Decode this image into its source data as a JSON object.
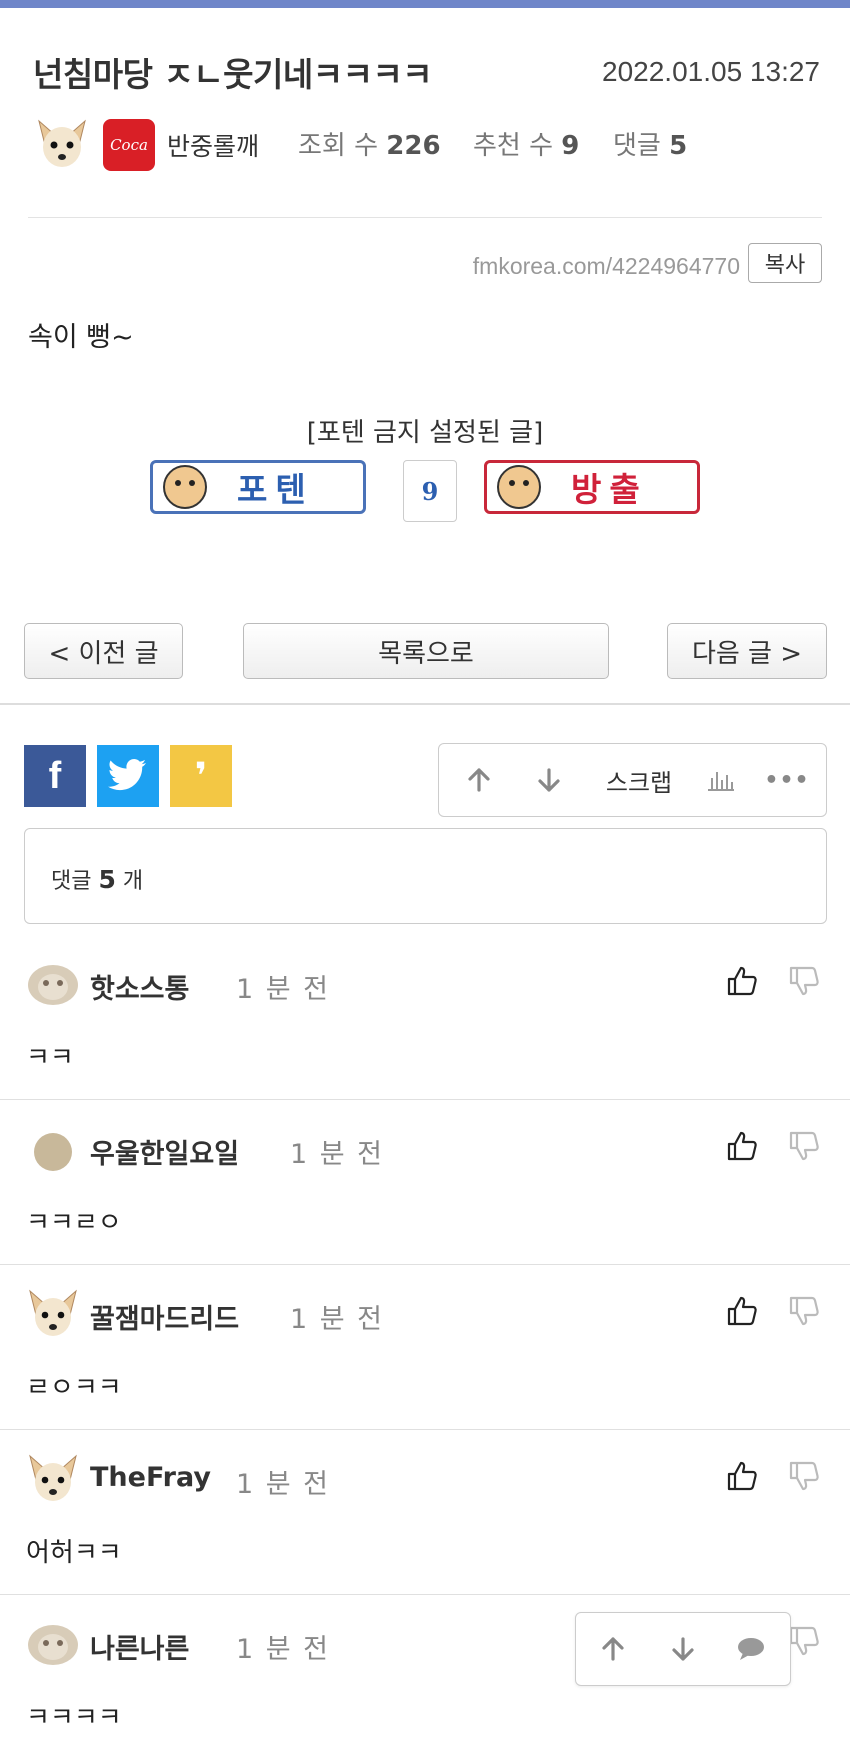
{
  "post": {
    "title": "넌침마당 ㅈㄴ웃기네ㅋㅋㅋㅋ",
    "datetime": "2022.01.05 13:27",
    "author": "반중롤깨",
    "badge_text": "Coca",
    "views_label": "조회 수",
    "views": "226",
    "recommend_label": "추천 수",
    "recommend": "9",
    "comments_label": "댓글",
    "comments": "5",
    "url": "fmkorea.com/4224964770",
    "copy_label": "복사",
    "body": "속이 뻥~"
  },
  "vote": {
    "notice": "[포텐 금지 설정된 글]",
    "up_label": "포텐",
    "down_label": "방출",
    "count": "9"
  },
  "nav": {
    "prev": "< 이전 글",
    "list": "목록으로",
    "next": "다음 글 >"
  },
  "share": {
    "facebook": "f",
    "kakaostory": "❜"
  },
  "tools": {
    "scrap": "스크랩",
    "more": "•••"
  },
  "comment_summary": {
    "label": "댓글",
    "count": "5",
    "unit": "개"
  },
  "comments": [
    {
      "name": "핫소스통",
      "time": "1 분 전",
      "text": "ㅋㅋ",
      "avatar": "blurry-dog"
    },
    {
      "name": "우울한일요일",
      "time": "1 분 전",
      "text": "ㅋㅋㄹㅇ",
      "avatar": "dot"
    },
    {
      "name": "꿀잼마드리드",
      "time": "1 분 전",
      "text": "ㄹㅇㅋㅋ",
      "avatar": "dog"
    },
    {
      "name": "TheFray",
      "time": "1 분 전",
      "text": "어허ㅋㅋ",
      "avatar": "dog"
    },
    {
      "name": "나른나른",
      "time": "1 분 전",
      "text": "ㅋㅋㅋㅋ",
      "avatar": "blurry-dog"
    }
  ],
  "colors": {
    "topbar": "#6f86c9",
    "potent": "#2c5fb0",
    "eject": "#d0213a",
    "facebook": "#3b5998",
    "twitter": "#1da1f2",
    "kakaostory": "#f3c744"
  }
}
